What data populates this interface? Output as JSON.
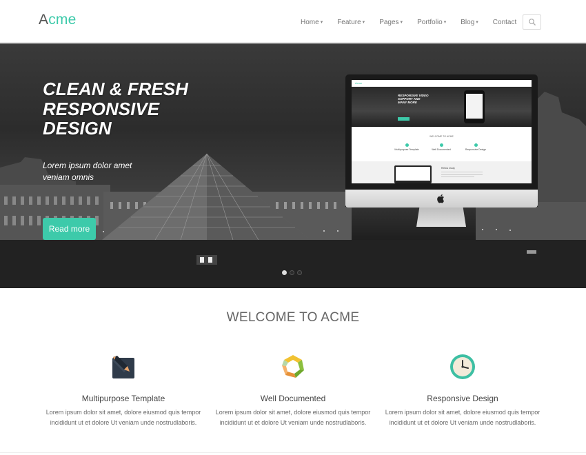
{
  "logo": {
    "first_letter": "A",
    "rest": "cme"
  },
  "nav": {
    "items": [
      {
        "label": "Home",
        "dropdown": true
      },
      {
        "label": "Feature",
        "dropdown": true
      },
      {
        "label": "Pages",
        "dropdown": true
      },
      {
        "label": "Portfolio",
        "dropdown": true
      },
      {
        "label": "Blog",
        "dropdown": true
      },
      {
        "label": "Contact",
        "dropdown": false
      }
    ],
    "search_icon": "search-icon"
  },
  "hero": {
    "title_lines": [
      "CLEAN & FRESH",
      "RESPONSIVE",
      "DESIGN"
    ],
    "subtitle_lines": [
      "Lorem ipsum dolor amet",
      "veniam omnis"
    ],
    "button_label": "Read more",
    "active_slide": 1,
    "slide_count": 3,
    "monitor": {
      "logo": "Acme",
      "hero_lines": [
        "RESPONSIVE VIDEO",
        "SUPPORT AND",
        "MANY MORE"
      ],
      "welcome": "WELCOME TO ACME",
      "columns": [
        "Multipurpose Template",
        "Well Documented",
        "Responsive Design"
      ],
      "band_title": "Retina ready"
    }
  },
  "welcome": {
    "title": "WELCOME TO ACME",
    "features": [
      {
        "icon": "pencil-icon",
        "title": "Multipurpose Template",
        "desc_line1": "Lorem ipsum dolor sit amet, dolore eiusmod quis tempor",
        "desc_line2": "incididunt ut et dolore Ut veniam unde nostrudlaboris."
      },
      {
        "icon": "recycle-arrows-icon",
        "title": "Well Documented",
        "desc_line1": "Lorem ipsum dolor sit amet, dolore eiusmod quis tempor",
        "desc_line2": "incididunt ut et dolore Ut veniam unde nostrudlaboris."
      },
      {
        "icon": "clock-icon",
        "title": "Responsive Design",
        "desc_line1": "Lorem ipsum dolor sit amet, dolore eiusmod quis tempor",
        "desc_line2": "incididunt ut et dolore Ut veniam unde nostrudlaboris."
      }
    ]
  },
  "colors": {
    "accent": "#3dcaaa",
    "hero_text": "#ffffff",
    "heading": "#666666"
  }
}
